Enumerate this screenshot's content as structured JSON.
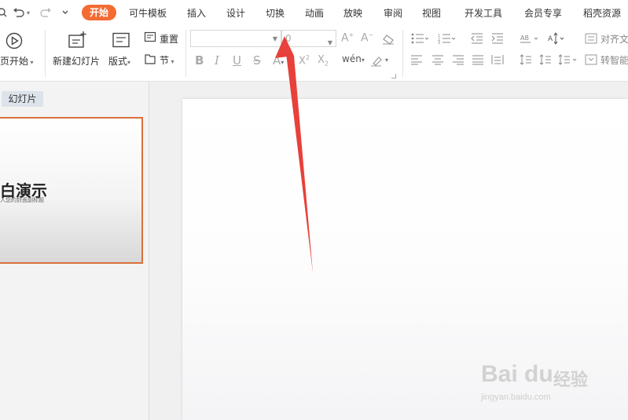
{
  "menubar": {
    "tabs": [
      "开始",
      "可牛模板",
      "插入",
      "设计",
      "切换",
      "动画",
      "放映",
      "审阅",
      "视图",
      "开发工具",
      "会员专享",
      "稻壳资源"
    ],
    "active_tab": "开始",
    "accent_color": "#f36b33"
  },
  "ribbon": {
    "play_label": "页开始",
    "new_slide_label": "新建幻灯片",
    "layout_label": "版式",
    "reset_label": "重置",
    "section_label": "节",
    "font_name": "",
    "font_size": "0",
    "align_text_label": "对齐文",
    "smart_label": "转智能"
  },
  "thumb_pane": {
    "tab_label": "幻灯片",
    "slide_title": "白演示",
    "slide_subtitle": "入您的封面副标题",
    "border_color": "#d9703a"
  },
  "annotation": {
    "arrow_color": "#e8403a"
  },
  "watermark": {
    "logo": "Bai du",
    "brand": "经验",
    "url": "jingyan.baidu.com"
  }
}
